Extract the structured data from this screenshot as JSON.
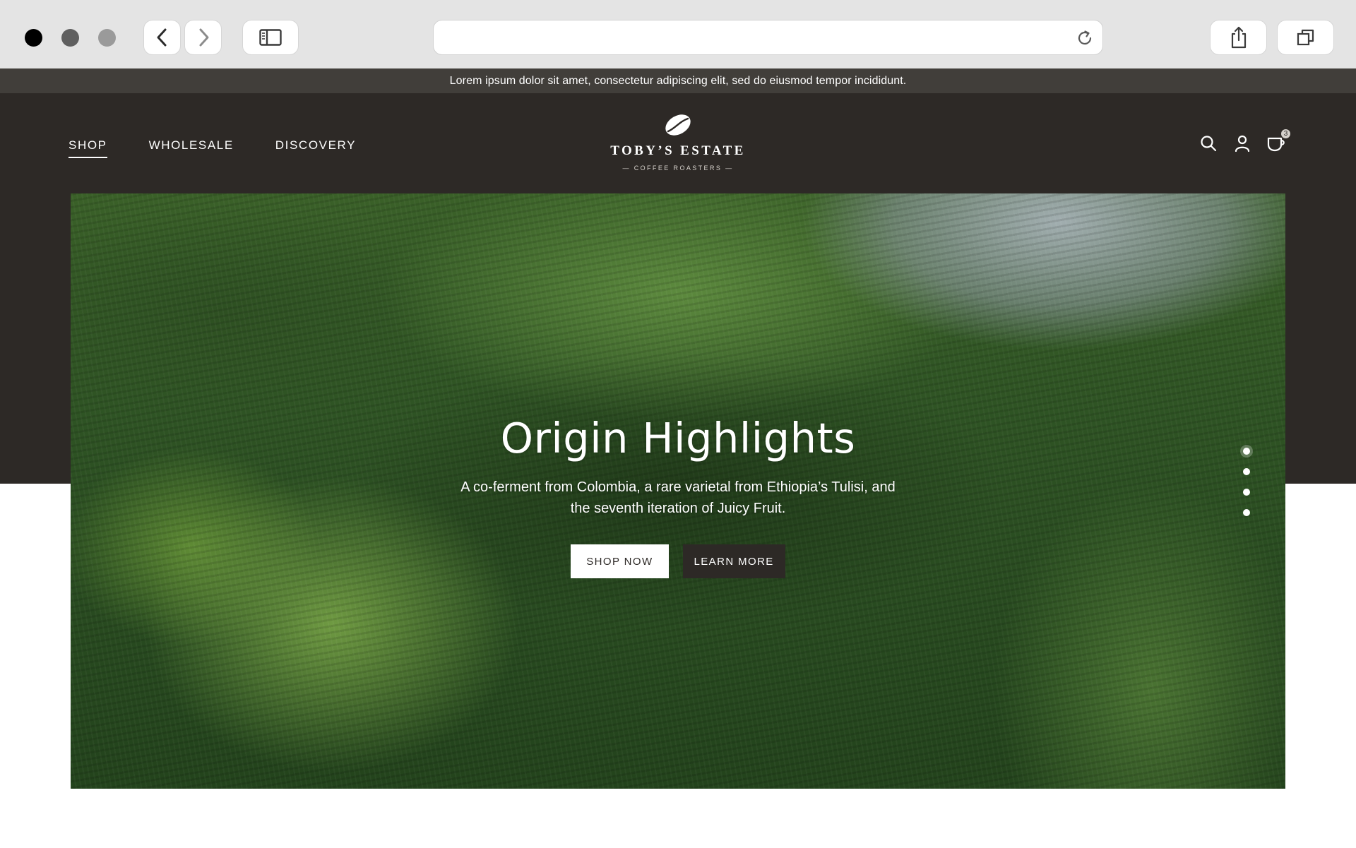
{
  "browser": {
    "address_value": "",
    "address_placeholder": "",
    "icons": [
      "back-icon",
      "forward-icon",
      "sidebar-icon",
      "reload-icon",
      "share-icon",
      "tabs-icon"
    ]
  },
  "announcement": "Lorem ipsum dolor sit amet, consectetur adipiscing elit, sed do eiusmod tempor incididunt.",
  "header": {
    "nav": [
      {
        "label": "SHOP",
        "active": true
      },
      {
        "label": "WHOLESALE",
        "active": false
      },
      {
        "label": "DISCOVERY",
        "active": false
      }
    ],
    "logo": {
      "name": "TOBY’S ESTATE",
      "subtitle": "— COFFEE ROASTERS —",
      "icon": "coffee-bean-icon"
    },
    "icons": [
      "search-icon",
      "account-icon",
      "cart-icon"
    ],
    "cart_count": "3"
  },
  "hero": {
    "title": "Origin Highlights",
    "description": "A co-ferment from Colombia, a rare varietal from Ethiopia’s Tulisi, and the seventh iteration of Juicy Fruit.",
    "primary_button": "SHOP NOW",
    "secondary_button": "LEARN MORE",
    "slides_total": 4,
    "active_slide": 1
  },
  "colors": {
    "brand_dark": "#2d2926",
    "announcement_bg": "#413e3a",
    "chrome_bg": "#e4e4e4",
    "foliage": "#2f5424"
  }
}
